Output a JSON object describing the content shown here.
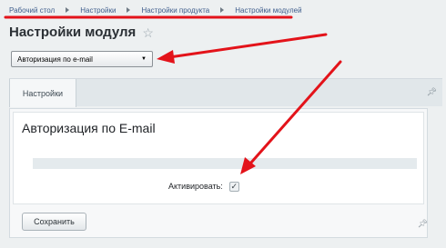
{
  "breadcrumb": {
    "items": [
      "Рабочий стол",
      "Настройки",
      "Настройки продукта",
      "Настройки модулей"
    ]
  },
  "page": {
    "title": "Настройки модуля"
  },
  "module_select": {
    "value": "Авторизация по e-mail"
  },
  "tabs": [
    {
      "label": "Настройки",
      "active": true
    }
  ],
  "section": {
    "title": "Авторизация по E-mail",
    "activate_label": "Активировать:",
    "activate_checked": true
  },
  "actions": {
    "save_label": "Сохранить"
  },
  "annotation": {
    "color": "#e3131a"
  },
  "icons": {
    "favorite": "star-icon",
    "pin": "pin-icon",
    "dropdown": "chevron-down-icon",
    "breadcrumb_separator": "chevron-right-icon"
  }
}
